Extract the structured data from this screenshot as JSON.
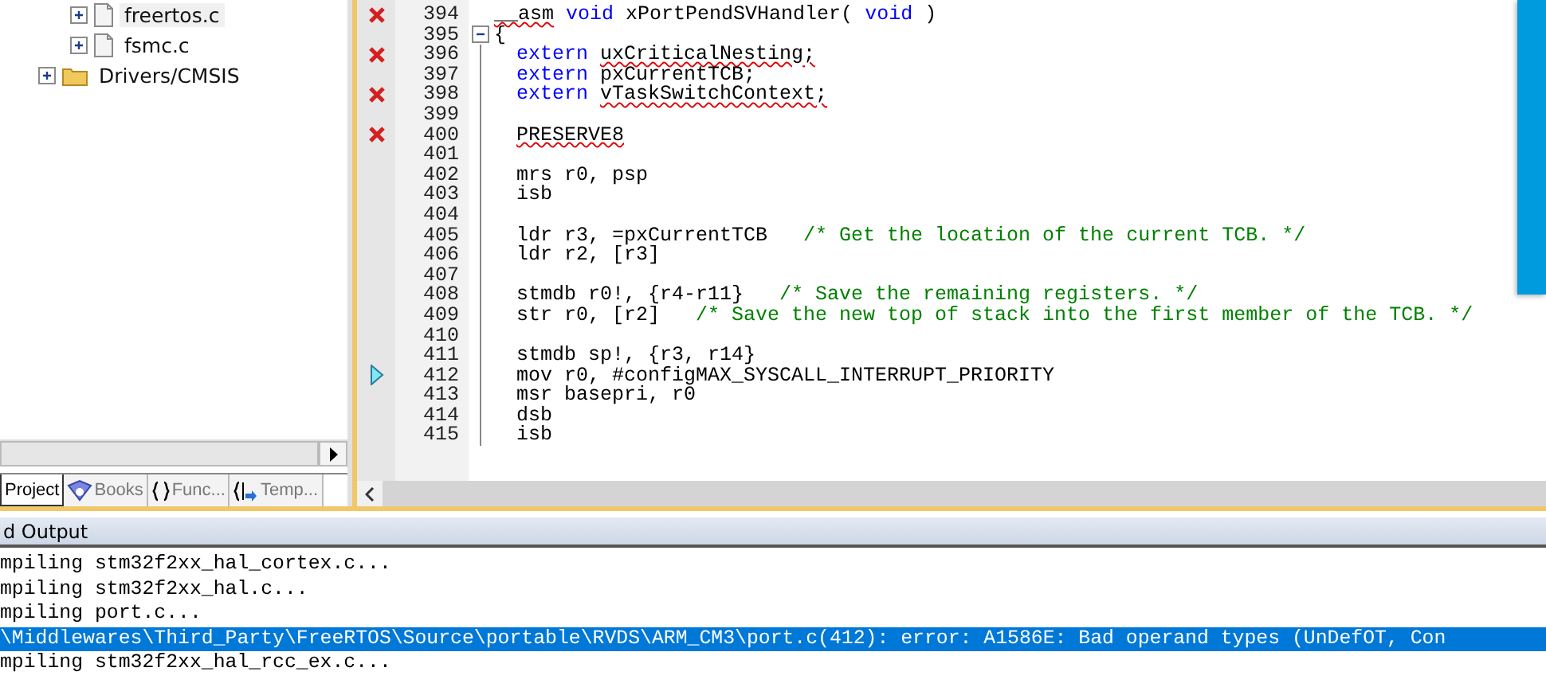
{
  "project_tree": [
    {
      "label": "freertos.c",
      "kind": "file",
      "highlighted": true
    },
    {
      "label": "fsmc.c",
      "kind": "file",
      "highlighted": false
    },
    {
      "label": "Drivers/CMSIS",
      "kind": "folder",
      "highlighted": false
    }
  ],
  "panel_tabs": [
    {
      "label": "Project",
      "kind": "project",
      "selected": true
    },
    {
      "label": "Books",
      "kind": "books",
      "selected": false
    },
    {
      "label": "Func...",
      "kind": "functions",
      "selected": false
    },
    {
      "label": "Temp...",
      "kind": "templates",
      "selected": false
    }
  ],
  "editor": {
    "lines": [
      {
        "number": "394",
        "error": true,
        "current": false,
        "fold_start": false,
        "indented": false,
        "segments": [
          {
            "text": "__asm",
            "kind": "squiggle"
          },
          {
            "text": "void",
            "kind": "keyword"
          },
          {
            "text": "xPortPendSVHandler(",
            "kind": "plain"
          },
          {
            "text": "void",
            "kind": "keyword"
          },
          {
            "text": ")",
            "kind": "plain"
          }
        ]
      },
      {
        "number": "395",
        "error": false,
        "current": false,
        "fold_start": true,
        "indented": false,
        "segments": [
          {
            "text": "{",
            "kind": "plain"
          }
        ]
      },
      {
        "number": "396",
        "error": true,
        "current": false,
        "fold_start": false,
        "indented": true,
        "segments": [
          {
            "text": "extern",
            "kind": "keyword"
          },
          {
            "text": "uxCriticalNesting;",
            "kind": "squiggle"
          }
        ]
      },
      {
        "number": "397",
        "error": false,
        "current": false,
        "fold_start": false,
        "indented": true,
        "segments": [
          {
            "text": "extern",
            "kind": "keyword"
          },
          {
            "text": "pxCurrentTCB;",
            "kind": "plain"
          }
        ]
      },
      {
        "number": "398",
        "error": true,
        "current": false,
        "fold_start": false,
        "indented": true,
        "segments": [
          {
            "text": "extern",
            "kind": "keyword"
          },
          {
            "text": "vTaskSwitchContext;",
            "kind": "squiggle"
          }
        ]
      },
      {
        "number": "399",
        "error": false,
        "current": false,
        "fold_start": false
      },
      {
        "number": "400",
        "error": true,
        "current": false,
        "fold_start": false,
        "indented": true,
        "segments": [
          {
            "text": "PRESERVE8",
            "kind": "squiggle"
          }
        ]
      },
      {
        "number": "401",
        "error": false,
        "current": false,
        "fold_start": false
      },
      {
        "number": "402",
        "error": false,
        "current": false,
        "fold_start": false,
        "indented": true,
        "segments": [
          {
            "text": "mrs r0, psp",
            "kind": "plain"
          }
        ]
      },
      {
        "number": "403",
        "error": false,
        "current": false,
        "fold_start": false,
        "indented": true,
        "segments": [
          {
            "text": "isb",
            "kind": "plain"
          }
        ]
      },
      {
        "number": "404",
        "error": false,
        "current": false,
        "fold_start": false
      },
      {
        "number": "405",
        "error": false,
        "current": false,
        "fold_start": false,
        "indented": true,
        "segments": [
          {
            "text": "ldr r3, =pxCurrentTCB",
            "kind": "plain"
          },
          {
            "text": "/* Get the location of the current TCB. */",
            "kind": "comment"
          }
        ]
      },
      {
        "number": "406",
        "error": false,
        "current": false,
        "fold_start": false,
        "indented": true,
        "segments": [
          {
            "text": "ldr r2, [r3]",
            "kind": "plain"
          }
        ]
      },
      {
        "number": "407",
        "error": false,
        "current": false,
        "fold_start": false
      },
      {
        "number": "408",
        "error": false,
        "current": false,
        "fold_start": false,
        "indented": true,
        "segments": [
          {
            "text": "stmdb r0!, {r4-r11}",
            "kind": "plain"
          },
          {
            "text": "/* Save the remaining registers. */",
            "kind": "comment"
          }
        ]
      },
      {
        "number": "409",
        "error": false,
        "current": false,
        "fold_start": false,
        "indented": true,
        "segments": [
          {
            "text": "str r0, [r2]",
            "kind": "plain"
          },
          {
            "text": "/* Save the new top of stack into the first member of the TCB. */",
            "kind": "comment"
          }
        ]
      },
      {
        "number": "410",
        "error": false,
        "current": false,
        "fold_start": false
      },
      {
        "number": "411",
        "error": false,
        "current": false,
        "fold_start": false,
        "indented": true,
        "segments": [
          {
            "text": "stmdb sp!, {r3, r14}",
            "kind": "plain"
          }
        ]
      },
      {
        "number": "412",
        "error": false,
        "current": true,
        "fold_start": false,
        "indented": true,
        "segments": [
          {
            "text": "mov r0, #configMAX_SYSCALL_INTERRUPT_PRIORITY",
            "kind": "plain"
          }
        ]
      },
      {
        "number": "413",
        "error": false,
        "current": false,
        "fold_start": false,
        "indented": true,
        "segments": [
          {
            "text": "msr basepri, r0",
            "kind": "plain"
          }
        ]
      },
      {
        "number": "414",
        "error": false,
        "current": false,
        "fold_start": false,
        "indented": true,
        "segments": [
          {
            "text": "dsb",
            "kind": "plain"
          }
        ]
      },
      {
        "number": "415",
        "error": false,
        "current": false,
        "fold_start": false,
        "indented": true,
        "segments": [
          {
            "text": "isb",
            "kind": "plain"
          }
        ]
      }
    ]
  },
  "output": {
    "title": "d Output",
    "lines": [
      {
        "text": "mpiling stm32f2xx_hal_cortex.c...",
        "selected": false
      },
      {
        "text": "mpiling stm32f2xx_hal.c...",
        "selected": false
      },
      {
        "text": "mpiling port.c...",
        "selected": false
      },
      {
        "text": "\\Middlewares\\Third_Party\\FreeRTOS\\Source\\portable\\RVDS\\ARM_CM3\\port.c(412): error: A1586E: Bad operand types (UnDefOT, Con",
        "selected": true
      },
      {
        "text": "mpiling stm32f2xx_hal_rcc_ex.c...",
        "selected": false
      }
    ]
  }
}
